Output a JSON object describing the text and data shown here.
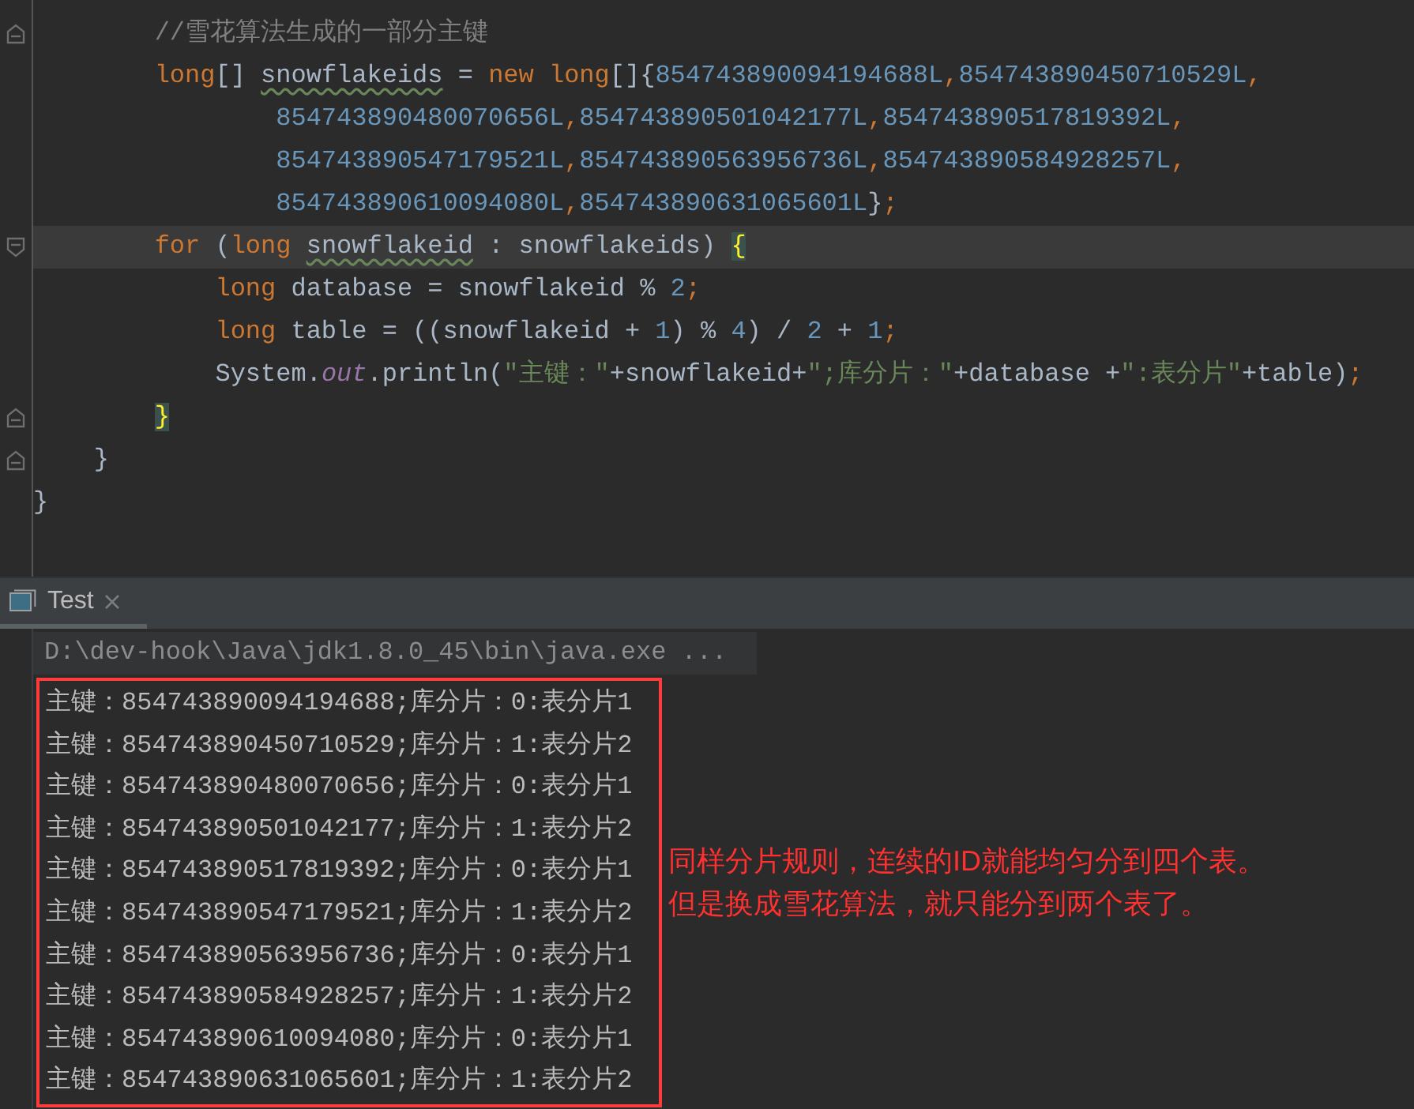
{
  "editor": {
    "lines": [
      {
        "current": false,
        "fold_start": false,
        "fold_end": true,
        "tokens": [
          {
            "kind": "com",
            "text": "        //雪花算法生成的一部分主键"
          }
        ]
      },
      {
        "current": false,
        "fold_start": false,
        "fold_end": false,
        "tokens": [
          {
            "kind": "kw",
            "text": "        long"
          },
          {
            "kind": "plain",
            "text": "[] "
          },
          {
            "kind": "warn",
            "text": "snowflakeids"
          },
          {
            "kind": "plain",
            "text": " = "
          },
          {
            "kind": "kw",
            "text": "new long"
          },
          {
            "kind": "plain",
            "text": "[]{"
          },
          {
            "kind": "num",
            "text": "854743890094194688L"
          },
          {
            "kind": "kw",
            "text": ","
          },
          {
            "kind": "num",
            "text": "854743890450710529L"
          },
          {
            "kind": "kw",
            "text": ","
          }
        ]
      },
      {
        "current": false,
        "fold_start": false,
        "fold_end": false,
        "tokens": [
          {
            "kind": "num",
            "text": "                854743890480070656L"
          },
          {
            "kind": "kw",
            "text": ","
          },
          {
            "kind": "num",
            "text": "854743890501042177L"
          },
          {
            "kind": "kw",
            "text": ","
          },
          {
            "kind": "num",
            "text": "854743890517819392L"
          },
          {
            "kind": "kw",
            "text": ","
          }
        ]
      },
      {
        "current": false,
        "fold_start": false,
        "fold_end": false,
        "tokens": [
          {
            "kind": "num",
            "text": "                854743890547179521L"
          },
          {
            "kind": "kw",
            "text": ","
          },
          {
            "kind": "num",
            "text": "854743890563956736L"
          },
          {
            "kind": "kw",
            "text": ","
          },
          {
            "kind": "num",
            "text": "854743890584928257L"
          },
          {
            "kind": "kw",
            "text": ","
          }
        ]
      },
      {
        "current": false,
        "fold_start": false,
        "fold_end": false,
        "tokens": [
          {
            "kind": "num",
            "text": "                854743890610094080L"
          },
          {
            "kind": "kw",
            "text": ","
          },
          {
            "kind": "num",
            "text": "854743890631065601L"
          },
          {
            "kind": "plain",
            "text": "}"
          },
          {
            "kind": "kw",
            "text": ";"
          }
        ]
      },
      {
        "current": true,
        "fold_start": true,
        "fold_end": false,
        "tokens": [
          {
            "kind": "kw",
            "text": "        for"
          },
          {
            "kind": "plain",
            "text": " ("
          },
          {
            "kind": "kw",
            "text": "long "
          },
          {
            "kind": "warn",
            "text": "snowflakeid"
          },
          {
            "kind": "plain",
            "text": " : snowflakeids) "
          },
          {
            "kind": "brace",
            "text": "{"
          }
        ]
      },
      {
        "current": false,
        "fold_start": false,
        "fold_end": false,
        "tokens": [
          {
            "kind": "kw",
            "text": "            long"
          },
          {
            "kind": "plain",
            "text": " database = snowflakeid % "
          },
          {
            "kind": "num",
            "text": "2"
          },
          {
            "kind": "kw",
            "text": ";"
          }
        ]
      },
      {
        "current": false,
        "fold_start": false,
        "fold_end": false,
        "tokens": [
          {
            "kind": "kw",
            "text": "            long"
          },
          {
            "kind": "plain",
            "text": " table = ((snowflakeid + "
          },
          {
            "kind": "num",
            "text": "1"
          },
          {
            "kind": "plain",
            "text": ") % "
          },
          {
            "kind": "num",
            "text": "4"
          },
          {
            "kind": "plain",
            "text": ") / "
          },
          {
            "kind": "num",
            "text": "2"
          },
          {
            "kind": "plain",
            "text": " + "
          },
          {
            "kind": "num",
            "text": "1"
          },
          {
            "kind": "kw",
            "text": ";"
          }
        ]
      },
      {
        "current": false,
        "fold_start": false,
        "fold_end": false,
        "tokens": [
          {
            "kind": "plain",
            "text": "            System."
          },
          {
            "kind": "field",
            "text": "out"
          },
          {
            "kind": "plain",
            "text": ".println("
          },
          {
            "kind": "str",
            "text": "\"主键：\""
          },
          {
            "kind": "plain",
            "text": "+snowflakeid+"
          },
          {
            "kind": "str",
            "text": "\";库分片：\""
          },
          {
            "kind": "plain",
            "text": "+database +"
          },
          {
            "kind": "str",
            "text": "\":表分片\""
          },
          {
            "kind": "plain",
            "text": "+table)"
          },
          {
            "kind": "kw",
            "text": ";"
          }
        ]
      },
      {
        "current": false,
        "fold_start": false,
        "fold_end": true,
        "tokens": [
          {
            "kind": "brace",
            "text": "        }"
          }
        ]
      },
      {
        "current": false,
        "fold_start": false,
        "fold_end": true,
        "tokens": [
          {
            "kind": "plain",
            "text": "    }"
          }
        ]
      },
      {
        "current": false,
        "fold_start": false,
        "fold_end": false,
        "tokens": [
          {
            "kind": "plain",
            "text": "}"
          }
        ]
      }
    ]
  },
  "run_panel": {
    "tabs": [
      {
        "label": "Test",
        "selected": true
      }
    ],
    "command": "D:\\dev-hook\\Java\\jdk1.8.0_45\\bin\\java.exe ...",
    "output": [
      "主键：854743890094194688;库分片：0:表分片1",
      "主键：854743890450710529;库分片：1:表分片2",
      "主键：854743890480070656;库分片：0:表分片1",
      "主键：854743890501042177;库分片：1:表分片2",
      "主键：854743890517819392;库分片：0:表分片1",
      "主键：854743890547179521;库分片：1:表分片2",
      "主键：854743890563956736;库分片：0:表分片1",
      "主键：854743890584928257;库分片：1:表分片2",
      "主键：854743890610094080;库分片：0:表分片1",
      "主键：854743890631065601;库分片：1:表分片2"
    ],
    "annotation": [
      "同样分片规则，连续的ID就能均匀分到四个表。",
      "但是换成雪花算法，就只能分到两个表了。"
    ]
  }
}
